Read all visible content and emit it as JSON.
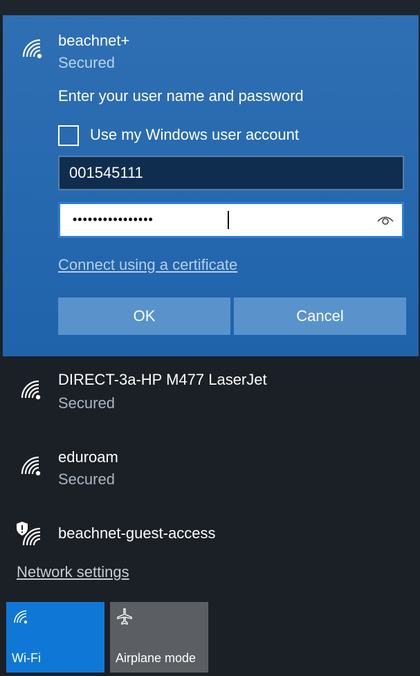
{
  "selected_network": {
    "name": "beachnet+",
    "status": "Secured",
    "prompt": "Enter your user name and password",
    "checkbox_label": "Use my Windows user account",
    "checkbox_checked": false,
    "username_value": "001545111",
    "password_masked": "••••••••••••••••",
    "reveal_icon": "eye-icon",
    "certificate_link": "Connect using a certificate",
    "ok_label": "OK",
    "cancel_label": "Cancel"
  },
  "networks": [
    {
      "name": "DIRECT-3a-HP M477 LaserJet",
      "status": "Secured",
      "icon": "wifi-signal-icon"
    },
    {
      "name": "eduroam",
      "status": "Secured",
      "icon": "wifi-signal-icon"
    },
    {
      "name": "beachnet-guest-access",
      "status": "",
      "icon": "wifi-shield-icon"
    }
  ],
  "network_settings_link": "Network settings",
  "quick_actions": [
    {
      "label": "Wi-Fi",
      "icon": "wifi-icon",
      "active": true
    },
    {
      "label": "Airplane mode",
      "icon": "airplane-icon",
      "active": false
    }
  ],
  "colors": {
    "accent": "#0f78d6",
    "panel": "#2269b0",
    "background": "#1b2026"
  }
}
